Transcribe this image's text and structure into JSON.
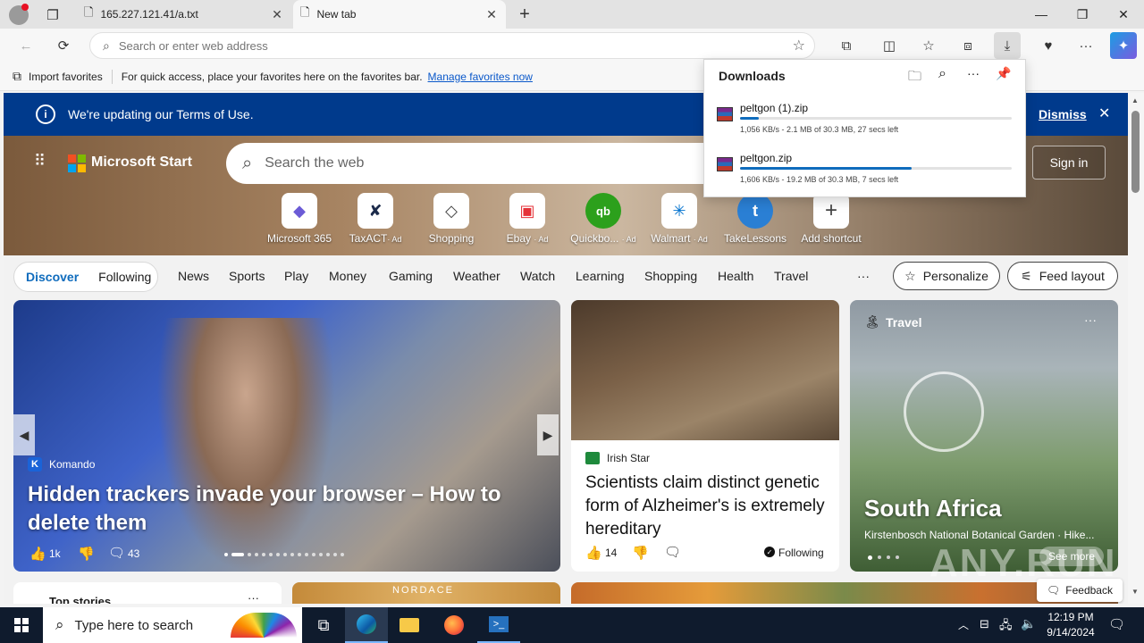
{
  "browser": {
    "tabs": [
      {
        "title": "165.227.121.41/a.txt",
        "active": false
      },
      {
        "title": "New tab",
        "active": true
      }
    ],
    "new_tab_glyph": "+",
    "address_placeholder": "Search or enter web address",
    "favorites_bar": {
      "import_label": "Import favorites",
      "hint": "For quick access, place your favorites here on the favorites bar.",
      "manage_link": "Manage favorites now"
    }
  },
  "downloads": {
    "title": "Downloads",
    "items": [
      {
        "name": "peltgon (1).zip",
        "status": "1,056 KB/s - 2.1 MB of 30.3 MB, 27 secs left",
        "progress": 0.07
      },
      {
        "name": "peltgon.zip",
        "status": "1,606 KB/s - 19.2 MB of 30.3 MB, 7 secs left",
        "progress": 0.63
      }
    ]
  },
  "notice": {
    "text": "We're updating our Terms of Use.",
    "dismiss": "Dismiss"
  },
  "msn": {
    "brand": "Microsoft Start",
    "search_placeholder": "Search the web",
    "sign_in": "Sign in",
    "shortcuts": [
      {
        "label": "Microsoft 365",
        "ad": "",
        "glyph": "◆",
        "color": "#6b5bd6"
      },
      {
        "label": "TaxACT",
        "ad": "· Ad",
        "glyph": "✘",
        "color": "#1b2a4a"
      },
      {
        "label": "Shopping",
        "ad": "",
        "glyph": "◇",
        "color": "#444444"
      },
      {
        "label": "Ebay",
        "ad": "· Ad",
        "glyph": "▣",
        "color": "#e53238"
      },
      {
        "label": "Quickbo...",
        "ad": "· Ad",
        "glyph": "qb",
        "color": "#2ca01c"
      },
      {
        "label": "Walmart",
        "ad": "· Ad",
        "glyph": "✳",
        "color": "#0071ce"
      },
      {
        "label": "TakeLessons",
        "ad": "",
        "glyph": "t",
        "color": "#2a7fd4"
      },
      {
        "label": "Add shortcut",
        "ad": "",
        "glyph": "+",
        "color": "#444444"
      }
    ],
    "feed_tabs": {
      "discover": "Discover",
      "following": "Following"
    },
    "nav": [
      "News",
      "Sports",
      "Play",
      "Money",
      "Gaming",
      "Weather",
      "Watch",
      "Learning",
      "Shopping",
      "Health",
      "Travel"
    ],
    "more": "···",
    "personalize": "Personalize",
    "feed_layout": "Feed layout"
  },
  "cards": {
    "main": {
      "source": "Komando",
      "source_initial": "K",
      "headline": "Hidden trackers invade your browser – How to delete them",
      "likes": "1k",
      "comments": "43"
    },
    "middle": {
      "source": "Irish Star",
      "headline": "Scientists claim distinct genetic form of Alzheimer's is extremely hereditary",
      "likes": "14",
      "following": "Following"
    },
    "travel": {
      "category": "Travel",
      "title": "South Africa",
      "subtitle": "Kirstenbosch National Botanical Garden · Hike...",
      "see_more": "See more"
    },
    "bottom": {
      "top_stories": "Top stories",
      "nordace": "NORDACE",
      "feedback": "Feedback"
    }
  },
  "taskbar": {
    "search_placeholder": "Type here to search",
    "time": "12:19 PM",
    "date": "9/14/2024"
  },
  "watermark": "ANY.RUN"
}
